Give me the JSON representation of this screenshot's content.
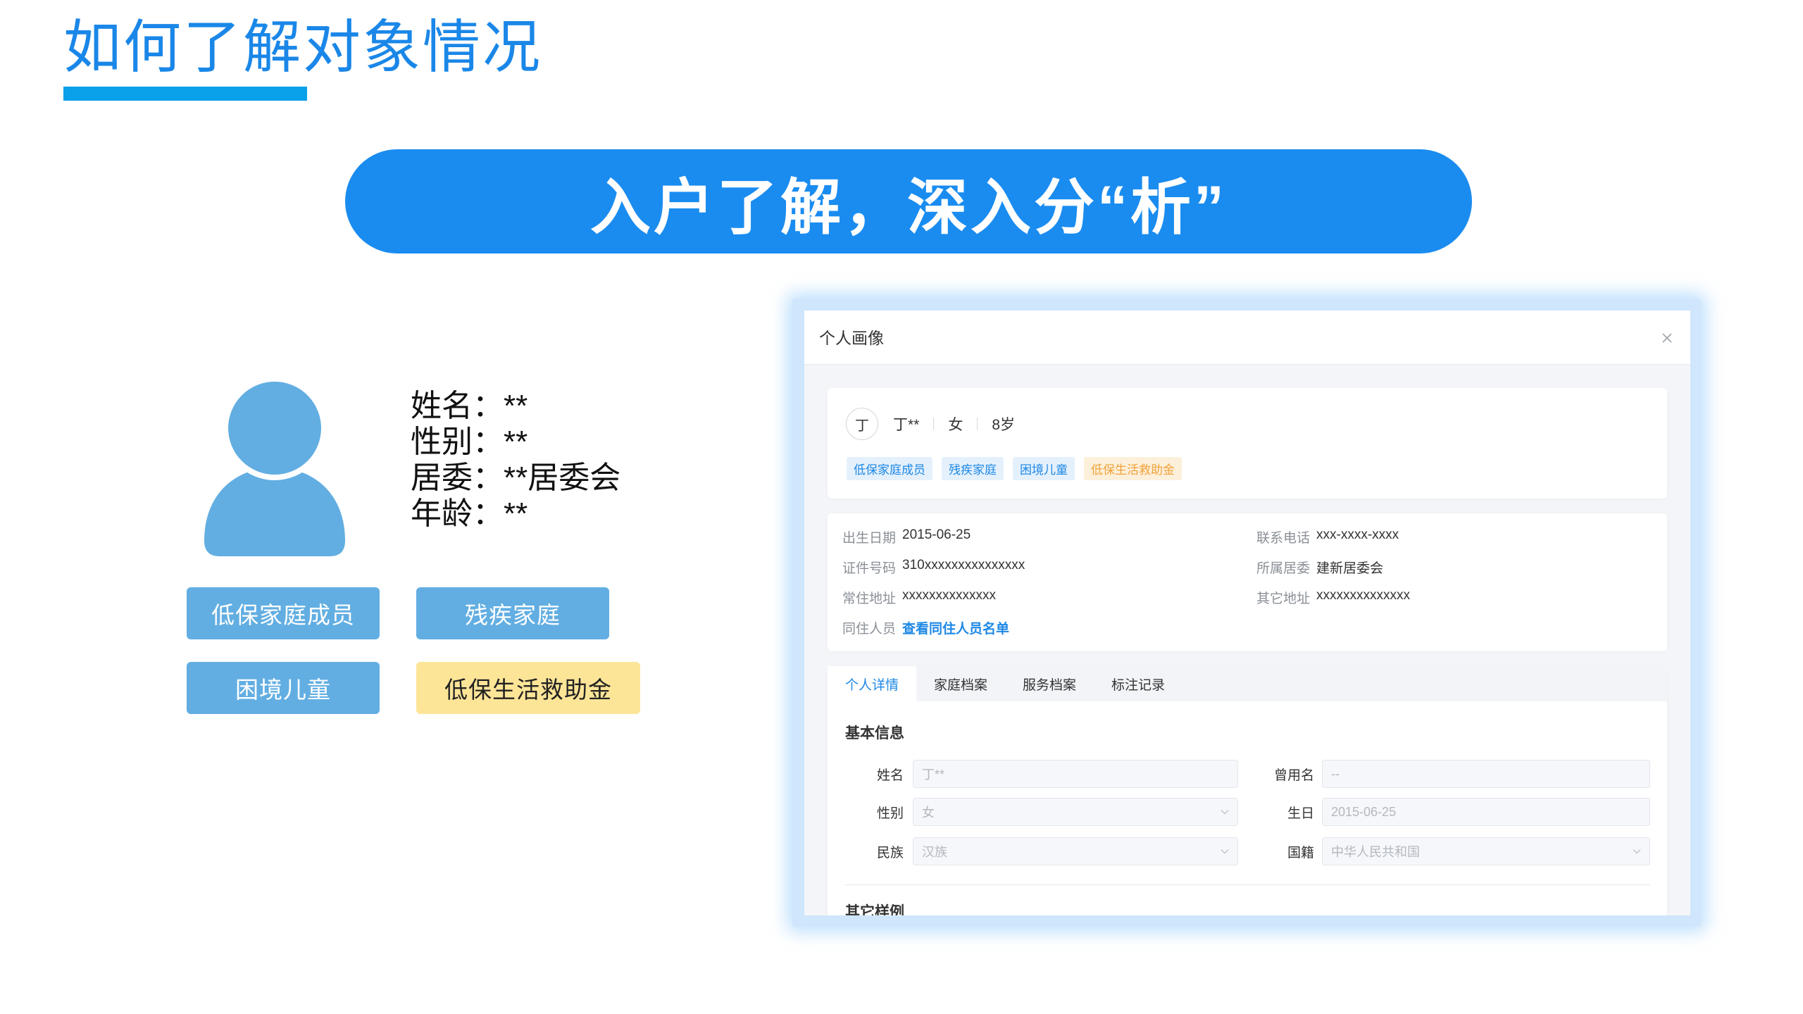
{
  "colors": {
    "title": "#1a87e8",
    "title_bar": "#0ba0ea",
    "banner": "#1a8cf0",
    "avatar": "#62aee2",
    "tag_blue": "#62aee2",
    "tag_yellow": "#fde598",
    "frame": "#cfe6fc",
    "link": "#1e88e5",
    "chip_blue_bg": "#e4f1fd",
    "chip_blue_text": "#1e88e5",
    "chip_yellow_bg": "#fdf0da",
    "chip_yellow_text": "#f0a23c"
  },
  "header": {
    "title": "如何了解对象情况"
  },
  "banner": {
    "text": "入户了解，深入分“析”"
  },
  "profile": {
    "avatar_icon": "user-icon",
    "fields": [
      {
        "label": "姓名：",
        "value": "**"
      },
      {
        "label": "性别：",
        "value": "**"
      },
      {
        "label": "居委：",
        "value": "**居委会"
      },
      {
        "label": "年龄：",
        "value": "**"
      }
    ],
    "tags": [
      {
        "text": "低保家庭成员"
      },
      {
        "text": "残疾家庭"
      },
      {
        "text": "困境儿童"
      },
      {
        "text": "低保生活救助金"
      }
    ]
  },
  "modal": {
    "title": "个人画像",
    "close_icon": "close-icon",
    "summary": {
      "avatar_char": "丁",
      "name": "丁**",
      "gender": "女",
      "age": "8岁",
      "tags": [
        {
          "text": "低保家庭成员"
        },
        {
          "text": "残疾家庭"
        },
        {
          "text": "困境儿童"
        },
        {
          "text": "低保生活救助金"
        }
      ]
    },
    "details": {
      "rows": [
        [
          {
            "label": "出生日期",
            "value": "2015-06-25"
          },
          {
            "label": "联系电话",
            "value": "xxx-xxxx-xxxx"
          }
        ],
        [
          {
            "label": "证件号码",
            "value": "310xxxxxxxxxxxxxxx"
          },
          {
            "label": "所属居委",
            "value": "建新居委会"
          }
        ],
        [
          {
            "label": "常住地址",
            "value": "xxxxxxxxxxxxxx"
          },
          {
            "label": "其它地址",
            "value": "xxxxxxxxxxxxxx"
          }
        ],
        [
          {
            "label": "同住人员",
            "value": "查看同住人员名单"
          }
        ]
      ]
    },
    "tabs": [
      {
        "label": "个人详情",
        "active": true
      },
      {
        "label": "家庭档案",
        "active": false
      },
      {
        "label": "服务档案",
        "active": false
      },
      {
        "label": "标注记录",
        "active": false
      }
    ],
    "basic_info": {
      "heading": "基本信息",
      "rows": [
        [
          {
            "label": "姓名",
            "value": "丁**"
          },
          {
            "label": "曾用名",
            "value": "--"
          }
        ],
        [
          {
            "label": "性别",
            "value": "女",
            "icon": "chevron-down-icon"
          },
          {
            "label": "生日",
            "value": "2015-06-25"
          }
        ],
        [
          {
            "label": "民族",
            "value": "汉族",
            "icon": "chevron-down-icon"
          },
          {
            "label": "国籍",
            "value": "中华人民共和国",
            "icon": "chevron-down-icon"
          }
        ]
      ]
    },
    "other_section": {
      "heading": "其它样例"
    }
  }
}
